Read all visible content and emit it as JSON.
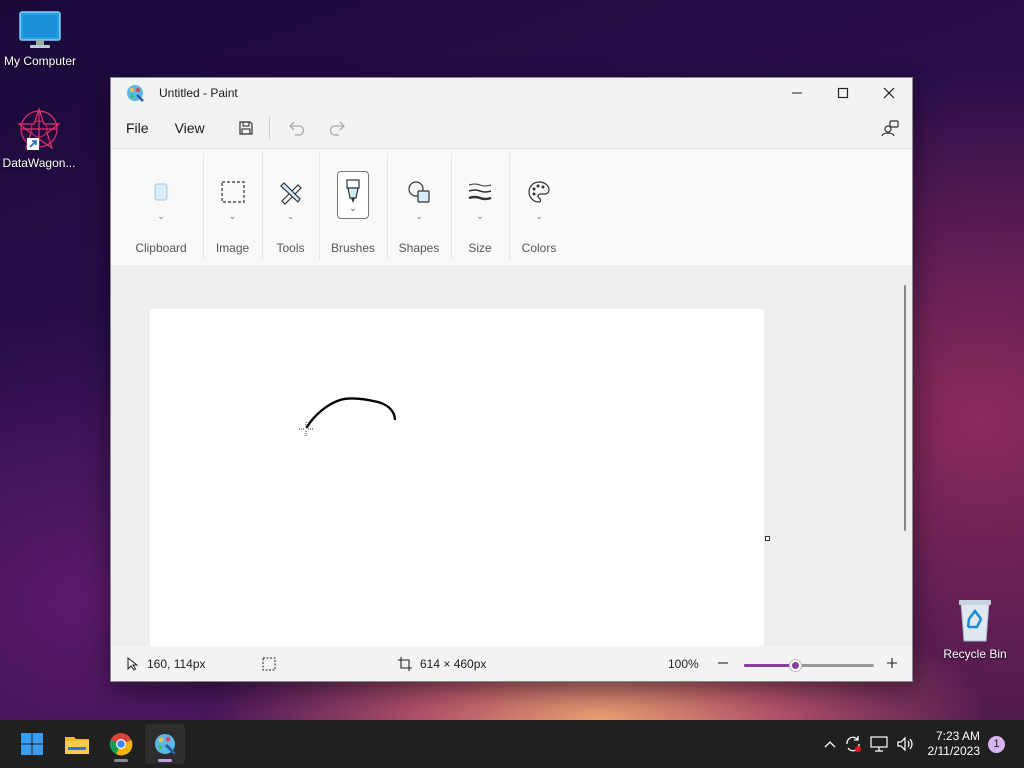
{
  "desktop": {
    "icons": [
      {
        "label": "My Computer"
      },
      {
        "label": "DataWagon..."
      },
      {
        "label": "Recycle Bin"
      }
    ]
  },
  "window": {
    "title": "Untitled - Paint",
    "menu": {
      "file": "File",
      "view": "View"
    },
    "ribbon": {
      "groups": [
        {
          "label": "Clipboard",
          "icon": "clipboard-icon"
        },
        {
          "label": "Image",
          "icon": "select-rectangle-icon"
        },
        {
          "label": "Tools",
          "icon": "tools-icon"
        },
        {
          "label": "Brushes",
          "icon": "brush-icon"
        },
        {
          "label": "Shapes",
          "icon": "shapes-icon"
        },
        {
          "label": "Size",
          "icon": "line-size-icon"
        },
        {
          "label": "Colors",
          "icon": "palette-icon"
        }
      ]
    },
    "status": {
      "cursor_pos": "160, 114px",
      "canvas_size": "614 × 460px",
      "zoom": "100%",
      "zoom_level": 0.39
    },
    "colors": {
      "accent": "#8b3a9e"
    }
  },
  "taskbar": {
    "time": "7:23 AM",
    "date": "2/11/2023",
    "notification_count": "1",
    "apps": [
      "start-icon",
      "file-explorer-icon",
      "chrome-icon",
      "paint-icon"
    ]
  }
}
